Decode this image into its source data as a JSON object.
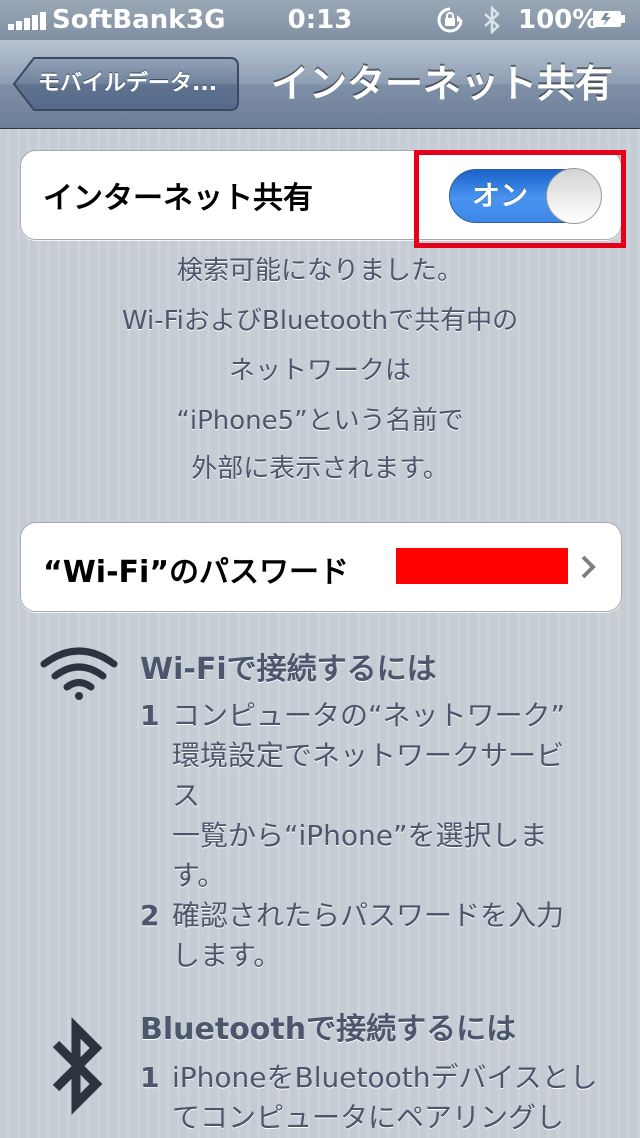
{
  "status_bar": {
    "carrier": "SoftBank",
    "network": "3G",
    "time": "0:13",
    "battery": "100%"
  },
  "nav": {
    "back_label": "モバイルデータ...",
    "title": "インターネット共有"
  },
  "sharing": {
    "label": "インターネット共有",
    "switch_label": "オン",
    "switch_on": true
  },
  "info_lines": [
    "検索可能になりました。",
    "Wi-FiおよびBluetoothで共有中の",
    "ネットワークは",
    "“iPhone5”という名前で",
    "外部に表示されます。"
  ],
  "password": {
    "label": "“Wi-Fi”のパスワード"
  },
  "wifi_section": {
    "icon": "wifi-icon",
    "heading": "Wi-Fiで接続するには",
    "steps": [
      {
        "num": "1",
        "lines": [
          "コンピュータの“ネットワーク”",
          "環境設定でネットワークサービ",
          "ス",
          "一覧から“iPhone”を選択しま",
          "す。"
        ]
      },
      {
        "num": "2",
        "lines": [
          "確認されたらパスワードを入力",
          "します。"
        ]
      }
    ]
  },
  "bluetooth_section": {
    "icon": "bluetooth-icon",
    "heading": "Bluetoothで接続するには",
    "steps": [
      {
        "num": "1",
        "lines": [
          "iPhoneをBluetoothデバイスとし",
          "てコンピュータにペアリングし"
        ]
      }
    ]
  },
  "colors": {
    "highlight": "#e6001a",
    "redaction": "#ff0000",
    "switch_on": "#3d88e8"
  }
}
